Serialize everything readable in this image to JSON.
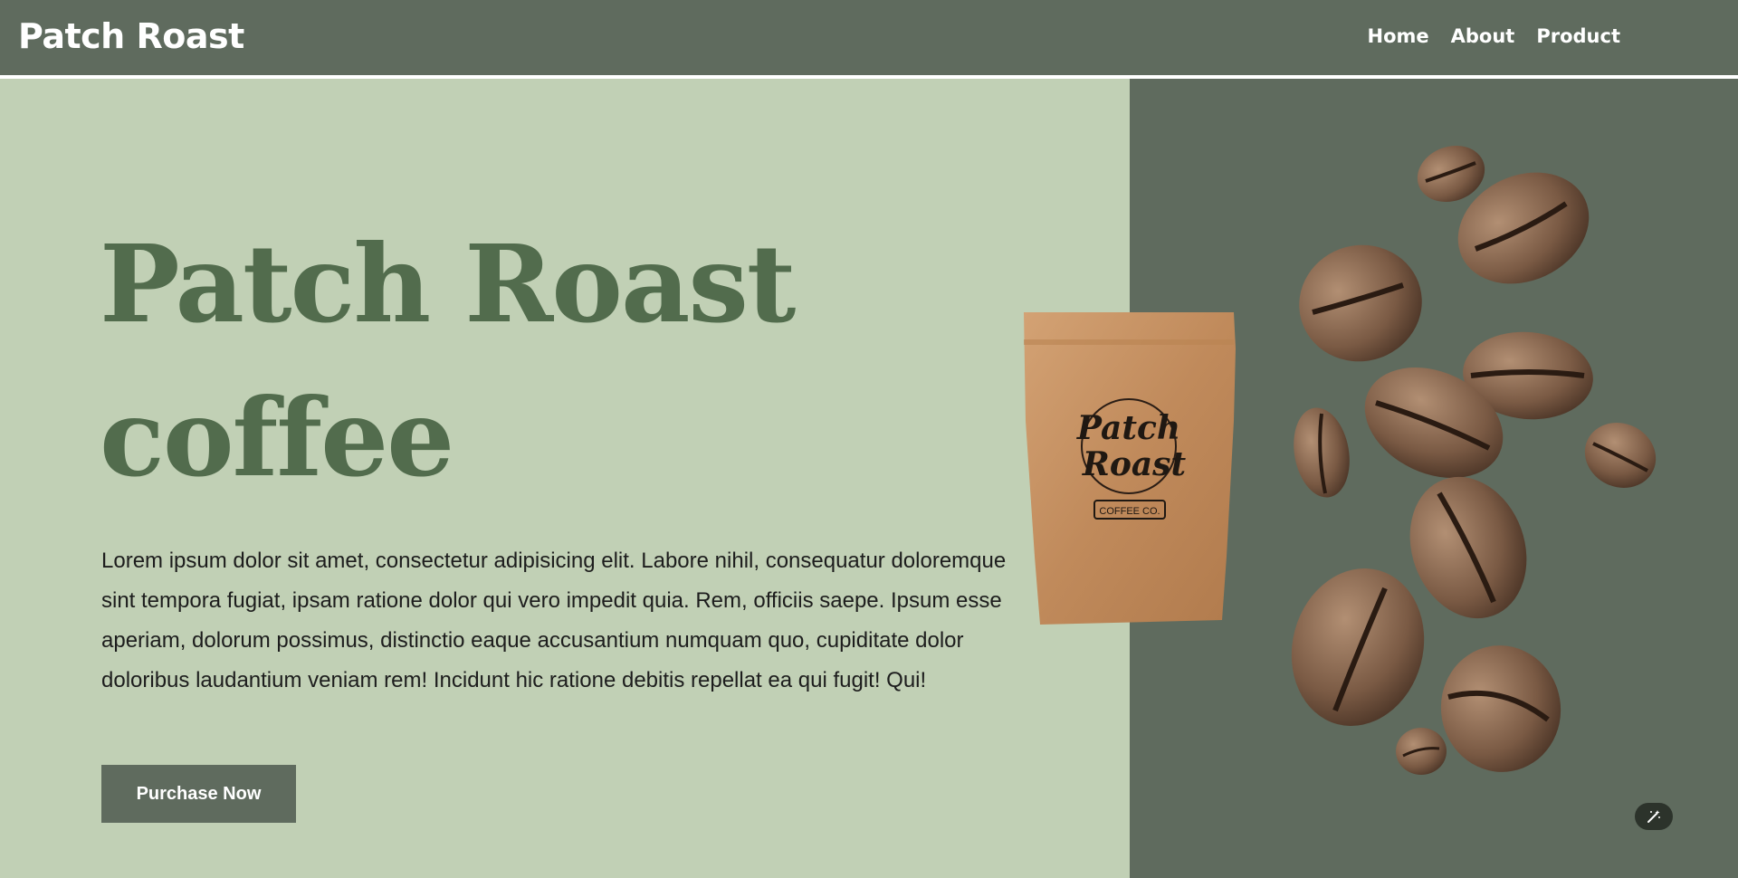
{
  "header": {
    "brand": "Patch Roast",
    "nav": [
      {
        "label": "Home"
      },
      {
        "label": "About"
      },
      {
        "label": "Product"
      }
    ]
  },
  "hero": {
    "title": "Patch Roast",
    "subtitle": "coffee",
    "body": "Lorem ipsum dolor sit amet, consectetur adipisicing elit. Labore nihil, consequatur doloremque sint tempora fugiat, ipsam ratione dolor qui vero impedit quia. Rem, officiis saepe. Ipsum esse aperiam, dolorum possimus, distinctio eaque accusantium numquam quo, cupiditate dolor doloribus laudantium veniam rem! Incidunt hic ratione debitis repellat ea qui fugit! Qui!",
    "cta_label": "Purchase Now"
  },
  "product_bag": {
    "brand_line1": "Patch",
    "brand_line2": "Roast",
    "tag": "COFFEE CO."
  },
  "colors": {
    "header_bg": "#5f6b5e",
    "hero_left_bg": "#c1d0b5",
    "hero_right_bg": "#5f6b5e",
    "title_green": "#526c4d",
    "text_dark": "#1d1d1d"
  },
  "icons": {
    "floating_action": "magic-wand-icon"
  }
}
